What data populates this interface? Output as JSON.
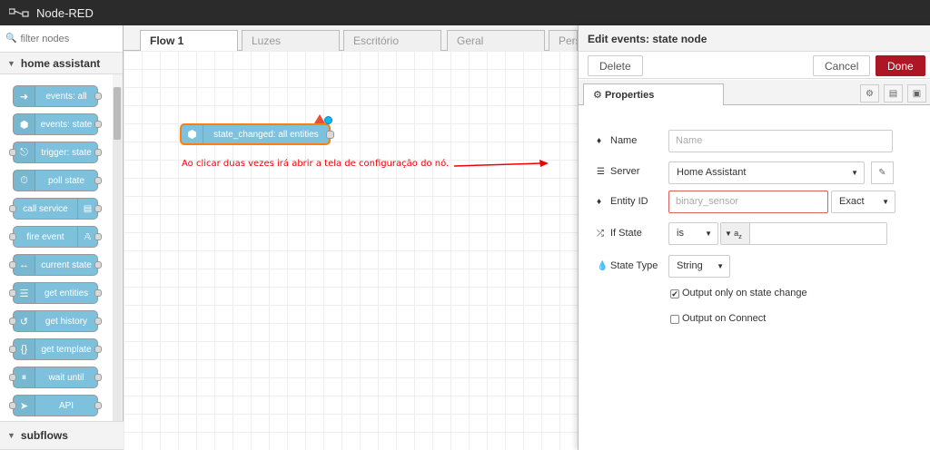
{
  "app": {
    "title": "Node-RED"
  },
  "palette": {
    "search_placeholder": "filter nodes",
    "category": "home assistant",
    "nodes": [
      {
        "label": "events: all",
        "icon": "arrow-right-icon"
      },
      {
        "label": "events: state",
        "icon": "hexagon-icon"
      },
      {
        "label": "trigger: state",
        "icon": "pulse-icon"
      },
      {
        "label": "poll state",
        "icon": "timer-icon"
      },
      {
        "label": "call service",
        "icon": "router-icon"
      },
      {
        "label": "fire event",
        "icon": "antenna-icon"
      },
      {
        "label": "current state",
        "icon": "code-icon"
      },
      {
        "label": "get entities",
        "icon": "list-icon"
      },
      {
        "label": "get history",
        "icon": "history-icon"
      },
      {
        "label": "get template",
        "icon": "template-icon"
      },
      {
        "label": "wait until",
        "icon": "pause-icon"
      },
      {
        "label": "API",
        "icon": "paper-plane-icon"
      }
    ],
    "subflows": "subflows"
  },
  "workspace": {
    "tabs": [
      "Flow 1",
      "Luzes",
      "Escritório",
      "Geral",
      "Pers"
    ],
    "active_tab": "Flow 1",
    "node_label": "state_changed: all entities",
    "annotation": "Ao clicar duas vezes irá abrir a tela de configuração do nó."
  },
  "tray": {
    "title": "Edit events: state node",
    "delete": "Delete",
    "cancel": "Cancel",
    "done": "Done",
    "properties_tab": "Properties",
    "fields": {
      "name_label": "Name",
      "name_placeholder": "Name",
      "server_label": "Server",
      "server_value": "Home Assistant",
      "entity_label": "Entity ID",
      "entity_placeholder": "binary_sensor",
      "entity_match": "Exact",
      "ifstate_label": "If State",
      "ifstate_op": "is",
      "statetype_label": "State Type",
      "statetype_value": "String",
      "cb_output_change": "Output only on state change",
      "cb_output_change_checked": true,
      "cb_output_connect": "Output on Connect",
      "cb_output_connect_checked": false
    }
  },
  "colors": {
    "node": "#7ec1dc",
    "done": "#ad1625",
    "annotation": "#e00000"
  }
}
